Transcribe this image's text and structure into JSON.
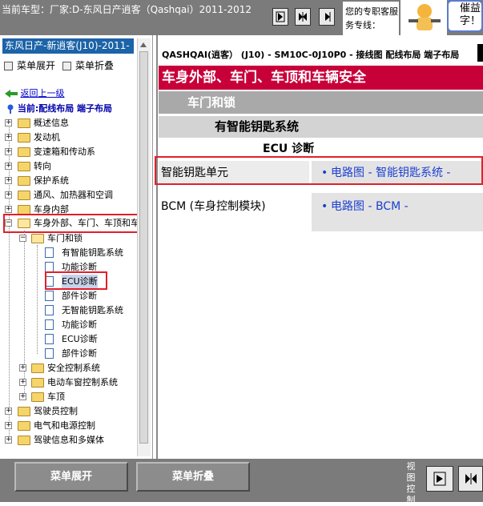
{
  "header": {
    "car_label": "当前车型：厂家:D-东风日产逍客（Qashqai）2011-2012",
    "hotline": "您的专职客服务专线：",
    "bubble": "催益字！",
    "nav_buttons": [
      "first-page-icon",
      "prev-page-icon"
    ]
  },
  "left_panel": {
    "vehicle_title": "东风日产-新逍客(J10)-2011-",
    "expand_label": "菜单展开",
    "collapse_label": "菜单折叠",
    "back_link": "返回上一级",
    "current_label": "当前:配线布局 端子布局",
    "tree": {
      "top_items": [
        "概述信息",
        "发动机",
        "变速箱和传动系",
        "转向",
        "保护系统",
        "通风、加热器和空调",
        "车身内部"
      ],
      "body_exterior": "车身外部、车门、车顶和车",
      "door_lock": "车门和锁",
      "door_lock_children": [
        "有智能钥匙系统",
        "功能诊断",
        "ECU诊断",
        "部件诊断",
        "无智能钥匙系统",
        "功能诊断",
        "ECU诊断",
        "部件诊断"
      ],
      "siblings": [
        "安全控制系统",
        "电动车窗控制系统",
        "车顶"
      ],
      "bottom_items": [
        "驾驶员控制",
        "电气和电源控制",
        "驾驶信息和多媒体"
      ]
    }
  },
  "right_panel": {
    "breadcrumb": "QASHQAI(逍客） (J10) - SM10C-0J10P0 - 接线图 配线布局 端子布局",
    "section_main": "车身外部、车门、车顶和车辆安全",
    "section_sub": "车门和锁",
    "section_system": "有智能钥匙系统",
    "section_ecu": "ECU 诊断",
    "rows": [
      {
        "name": "智能钥匙单元",
        "link": "电路图 - 智能钥匙系统 -"
      },
      {
        "name": "BCM (车身控制模块)",
        "link": "电路图 - BCM -"
      }
    ]
  },
  "bottom": {
    "expand_label": "菜单展开",
    "collapse_label": "菜单折叠",
    "view_label": "视图控制"
  },
  "colors": {
    "header_gray": "#7b7b7b",
    "section_red": "#c8003a",
    "highlight_red": "#e0202a",
    "link_blue": "#1c3fd0",
    "title_blue": "#1c63a8"
  }
}
